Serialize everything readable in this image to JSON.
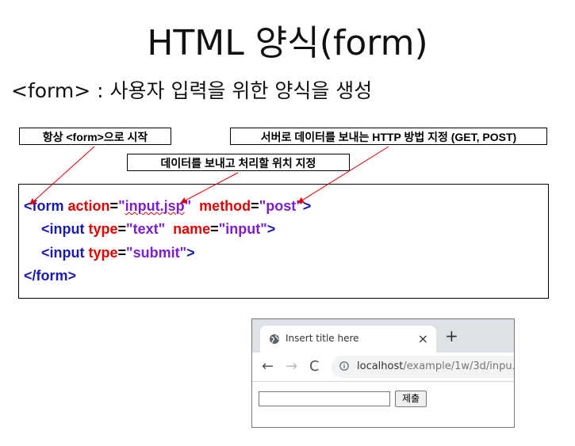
{
  "title": "HTML 양식(form)",
  "subtitle": "<form> : 사용자 입력을 위한 양식을 생성",
  "callouts": {
    "start": "항상 <form>으로 시작",
    "method": "서버로 데이터를 보내는 HTTP 방법 지정 (GET, POST)",
    "action": "데이터를 보내고 처리할 위치 지정"
  },
  "code": {
    "line1": {
      "open": "<form",
      "attr1": "action",
      "eq1": "=",
      "val1_q1": "\"",
      "val1": "input.jsp",
      "val1_q2": "\"",
      "attr2": "method",
      "eq2": "=",
      "val2": "\"post\"",
      "close": ">"
    },
    "line2": {
      "open": "<input",
      "attr1": "type",
      "eq1": "=",
      "val1": "\"text\"",
      "attr2": "name",
      "eq2": "=",
      "val2": "\"input\"",
      "close": ">"
    },
    "line3": {
      "open": "<input",
      "attr1": "type",
      "eq1": "=",
      "val1": "\"submit\"",
      "close": ">"
    },
    "line4": "</form>"
  },
  "browser": {
    "tab_title": "Insert title here",
    "tab_close": "×",
    "new_tab": "+",
    "back": "←",
    "forward": "→",
    "reload": "C",
    "url_host": "localhost",
    "url_path": "/example/1w/3d/inpu...",
    "submit_label": "제출"
  },
  "colors": {
    "tag": "#1a1ab0",
    "attribute": "#e00000",
    "value": "#7a1fd0",
    "arrow": "#e00000"
  }
}
